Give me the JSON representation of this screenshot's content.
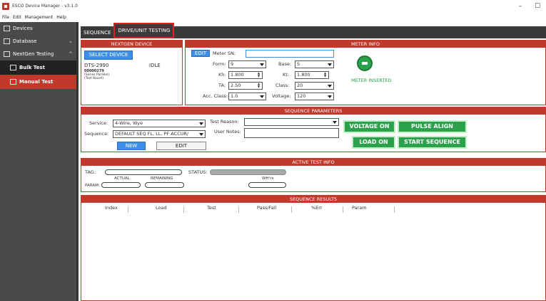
{
  "window": {
    "title": "ESCO Device Manager - v3.1.0",
    "minimize": "–",
    "maximize": "☐"
  },
  "menu": [
    "File",
    "Edit",
    "Management",
    "Help"
  ],
  "sidebar": {
    "items": [
      {
        "label": "Devices",
        "icon": "monitor-icon"
      },
      {
        "label": "Database",
        "icon": "database-icon",
        "chevron": "⌄"
      },
      {
        "label": "NextGen Testing",
        "icon": "nextgen-icon",
        "chevron": "^"
      }
    ],
    "subitems": [
      {
        "label": "Bulk Test",
        "icon": "bulk-test-icon",
        "active": false
      },
      {
        "label": "Manual Test",
        "icon": "manual-test-icon",
        "active": true
      }
    ]
  },
  "tabs": [
    {
      "label": "SEQUENCE",
      "active": false
    },
    {
      "label": "DRIVE/UNIT TESTING",
      "active": true
    }
  ],
  "nextgen_device": {
    "title": "NEXTGEN DEVICE",
    "select_button": "SELECT DEVICE",
    "device_id": "DTS-2990",
    "status": "IDLE",
    "serial": "00000279",
    "line1": "(Series Parallel)",
    "line2": "(Test Board)"
  },
  "meter_info": {
    "title": "METER INFO",
    "edit_button": "EDIT",
    "meter_sn_label": "Meter SN:",
    "meter_sn_value": "",
    "form_label": "Form:",
    "form_value": "9",
    "base_label": "Base:",
    "base_value": "S",
    "kh_label": "Kh:",
    "kh_value": "1.800",
    "kt_label": "Kt:",
    "kt_value": "1.800",
    "ta_label": "TA:",
    "ta_value": "2.50",
    "class_label": "Class:",
    "class_value": "20",
    "acc_label": "Acc. Class:",
    "acc_value": "1.0",
    "voltage_label": "Voltage:",
    "voltage_value": "120",
    "status": "METER INSERTED"
  },
  "sequence_parameters": {
    "title": "SEQUENCE PARAMETERS",
    "service_label": "Service:",
    "service_value": "4-Wire, Wye",
    "sequence_label": "Sequence:",
    "sequence_value": "DEFAULT SEQ FL, LL, PF ACCUR/",
    "test_reason_label": "Test Reason:",
    "test_reason_value": "",
    "user_notes_label": "User Notes:",
    "user_notes_value": "",
    "new_button": "NEW",
    "edit_button": "EDIT",
    "voltage_on": "VOLTAGE ON",
    "pulse_align": "PULSE ALIGN",
    "load_on": "LOAD ON",
    "start_sequence": "START SEQUENCE"
  },
  "active_test": {
    "title": "ACTIVE TEST INFO",
    "tag_label": "TAG:",
    "status_label": "STATUS:",
    "actual_label": "ACTUAL",
    "remaining_label": "REMAINING",
    "whrs_label": "WH'rs",
    "param_label": "PARAM:"
  },
  "sequence_results": {
    "title": "SEQUENCE RESULTS",
    "columns": [
      "Index",
      "Load",
      "Test",
      "Pass/Fail",
      "%Err",
      "Param"
    ]
  },
  "colors": {
    "accent": "#c0392b",
    "sidebar": "#4a4a4a",
    "button_blue": "#3d8ee8",
    "button_green": "#2aa14a"
  }
}
